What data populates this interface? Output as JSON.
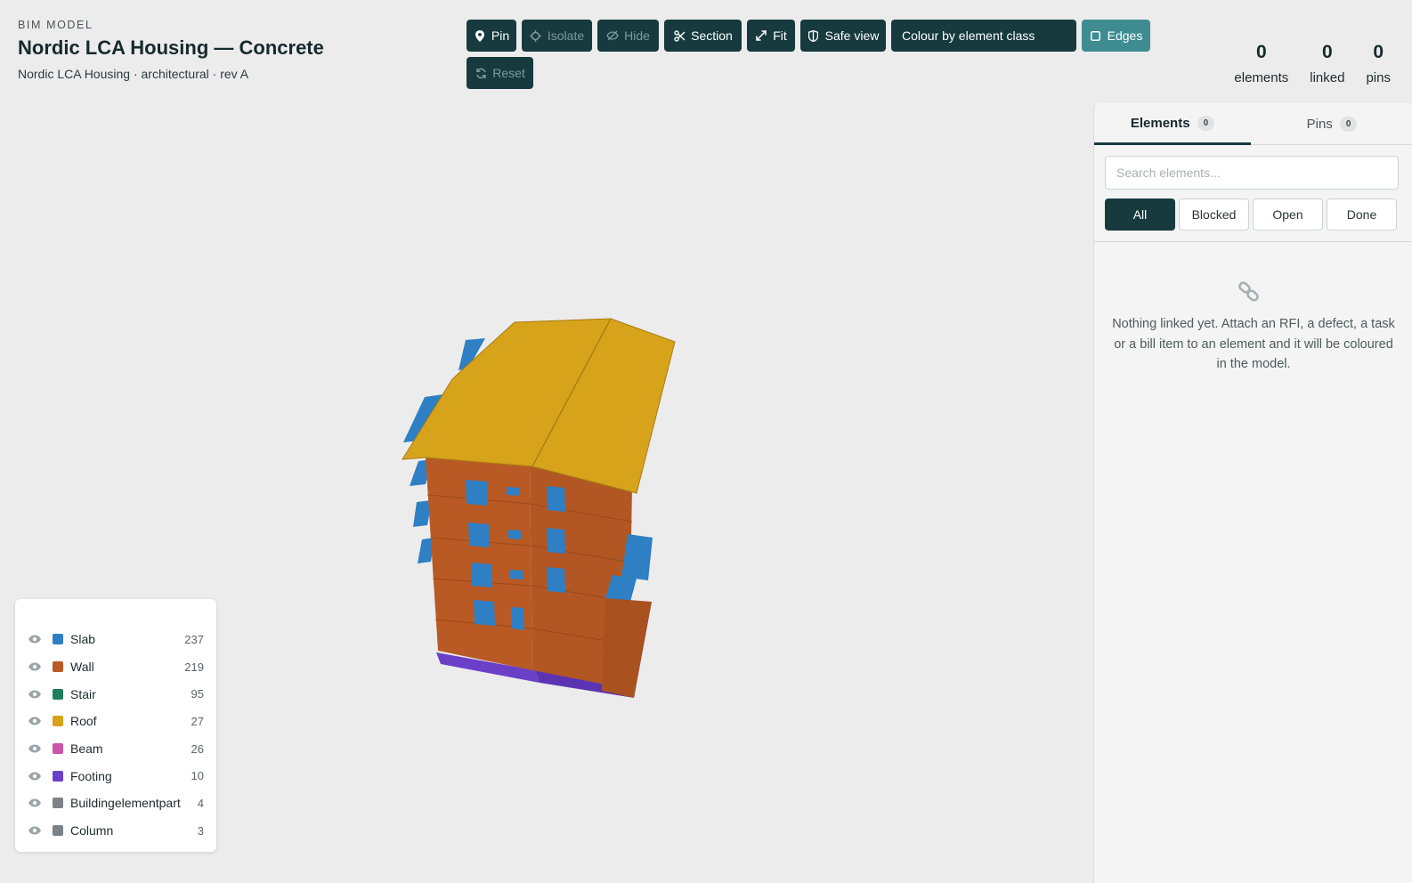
{
  "header": {
    "eyebrow": "BIM MODEL",
    "title": "Nordic LCA Housing — Concrete",
    "subtitle": "Nordic LCA Housing · architectural · rev A"
  },
  "toolbar": {
    "pin": "Pin",
    "isolate": "Isolate",
    "hide": "Hide",
    "section": "Section",
    "fit": "Fit",
    "safe_view": "Safe view",
    "colour_mode": "Colour by element class",
    "edges": "Edges",
    "reset": "Reset"
  },
  "stats": [
    {
      "value": "0",
      "label": "elements"
    },
    {
      "value": "0",
      "label": "linked"
    },
    {
      "value": "0",
      "label": "pins"
    }
  ],
  "legend": [
    {
      "name": "Slab",
      "count": "237",
      "color": "#2e7fc4"
    },
    {
      "name": "Wall",
      "count": "219",
      "color": "#b95a24"
    },
    {
      "name": "Stair",
      "count": "95",
      "color": "#1f7f5c"
    },
    {
      "name": "Roof",
      "count": "27",
      "color": "#d6a31b"
    },
    {
      "name": "Beam",
      "count": "26",
      "color": "#c956a8"
    },
    {
      "name": "Footing",
      "count": "10",
      "color": "#6b40c9"
    },
    {
      "name": "Buildingelementpart",
      "count": "4",
      "color": "#7c8186"
    },
    {
      "name": "Column",
      "count": "3",
      "color": "#7c8186"
    }
  ],
  "panel": {
    "tabs": [
      {
        "label": "Elements",
        "count": "0"
      },
      {
        "label": "Pins",
        "count": "0"
      }
    ],
    "search_placeholder": "Search elements...",
    "filters": [
      "All",
      "Blocked",
      "Open",
      "Done"
    ],
    "empty_message": "Nothing linked yet. Attach an RFI, a defect, a task or a bill item to an element and it will be coloured in the model."
  },
  "colors": {
    "primary": "#163a3e",
    "accent": "#3e8c92"
  }
}
